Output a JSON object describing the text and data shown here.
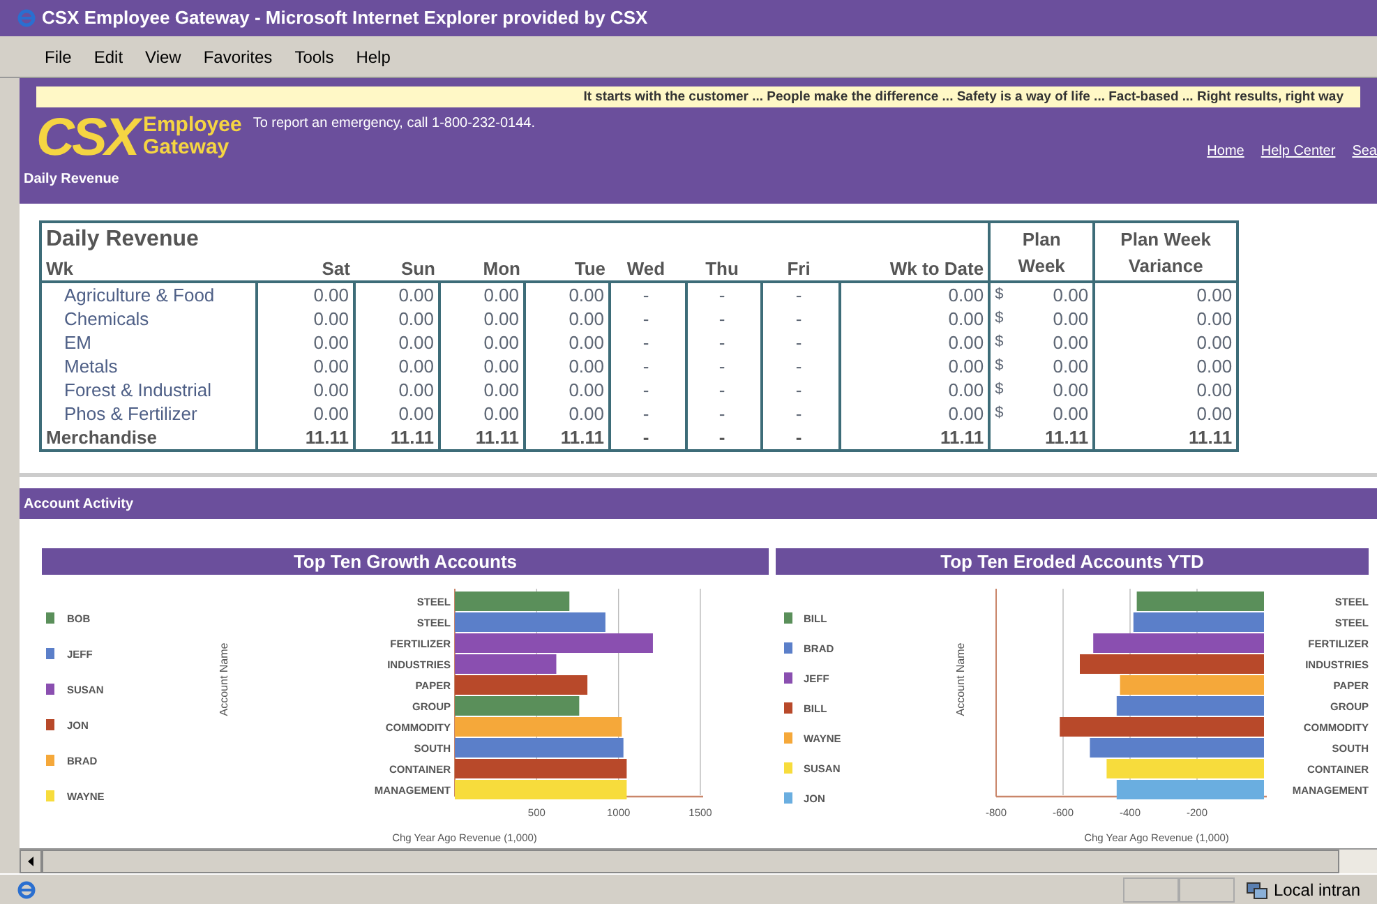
{
  "window": {
    "title": "CSX Employee Gateway - Microsoft Internet Explorer provided by CSX"
  },
  "menu": [
    "File",
    "Edit",
    "View",
    "Favorites",
    "Tools",
    "Help"
  ],
  "header": {
    "banner": "It starts with the customer ... People make the difference ... Safety is a way of life ... Fact-based ... Right results, right way",
    "logo": "CSX",
    "logo_lines": [
      "Employee",
      "Gateway"
    ],
    "emergency": "To report an emergency, call 1-800-232-0144.",
    "links": [
      "Home",
      "Help Center",
      "Sea"
    ],
    "section": "Daily Revenue"
  },
  "revenue": {
    "title": "Daily Revenue",
    "columns": [
      "Wk",
      "Sat",
      "Sun",
      "Mon",
      "Tue",
      "Wed",
      "Thu",
      "Fri",
      "Wk to Date",
      "Plan Week",
      "Plan Week Variance"
    ],
    "rows": [
      {
        "kind": "item",
        "cells": [
          "Agriculture & Food",
          "0.00",
          "0.00",
          "0.00",
          "0.00",
          "-",
          "-",
          "-",
          "0.00",
          "0.00",
          "0.00"
        ],
        "currency": "$"
      },
      {
        "kind": "item",
        "cells": [
          "Chemicals",
          "0.00",
          "0.00",
          "0.00",
          "0.00",
          "-",
          "-",
          "-",
          "0.00",
          "0.00",
          "0.00"
        ],
        "currency": "$"
      },
      {
        "kind": "item",
        "cells": [
          "EM",
          "0.00",
          "0.00",
          "0.00",
          "0.00",
          "-",
          "-",
          "-",
          "0.00",
          "0.00",
          "0.00"
        ],
        "currency": "$"
      },
      {
        "kind": "item",
        "cells": [
          "Metals",
          "0.00",
          "0.00",
          "0.00",
          "0.00",
          "-",
          "-",
          "-",
          "0.00",
          "0.00",
          "0.00"
        ],
        "currency": "$"
      },
      {
        "kind": "item",
        "cells": [
          "Forest & Industrial",
          "0.00",
          "0.00",
          "0.00",
          "0.00",
          "-",
          "-",
          "-",
          "0.00",
          "0.00",
          "0.00"
        ],
        "currency": "$"
      },
      {
        "kind": "item",
        "cells": [
          "Phos & Fertilizer",
          "0.00",
          "0.00",
          "0.00",
          "0.00",
          "-",
          "-",
          "-",
          "0.00",
          "0.00",
          "0.00"
        ],
        "currency": "$"
      },
      {
        "kind": "total",
        "cells": [
          "Merchandise",
          "11.11",
          "11.11",
          "11.11",
          "11.11",
          "-",
          "-",
          "-",
          "11.11",
          "11.11",
          "11.11"
        ]
      }
    ]
  },
  "activity": {
    "title": "Account Activity",
    "charts": [
      {
        "title": "Top Ten Growth Accounts",
        "chart_data": {
          "type": "bar",
          "orientation": "horizontal",
          "stacked": true,
          "legend": "left",
          "grid": true,
          "xlabel": "Chg Year Ago Revenue (1,000)",
          "ylabel": "Account Name",
          "categories": [
            "STEEL",
            "STEEL",
            "FERTILIZER",
            "INDUSTRIES",
            "PAPER",
            "GROUP",
            "COMMODITY",
            "SOUTH",
            "CONTAINER",
            "MANAGEMENT"
          ],
          "xlim": [
            0,
            1500
          ],
          "xticks": [
            500,
            1000,
            1500
          ],
          "series": [
            {
              "name": "BOB",
              "color": "#5a8f5a",
              "values": [
                700,
                null,
                null,
                null,
                null,
                760,
                null,
                null,
                null,
                null
              ]
            },
            {
              "name": "JEFF",
              "color": "#5b7fc9",
              "values": [
                null,
                920,
                null,
                null,
                null,
                null,
                null,
                1030,
                null,
                null
              ]
            },
            {
              "name": "SUSAN",
              "color": "#8a4fb0",
              "values": [
                null,
                null,
                1210,
                620,
                null,
                null,
                null,
                null,
                null,
                null
              ]
            },
            {
              "name": "JON",
              "color": "#b8492a",
              "values": [
                null,
                null,
                null,
                null,
                810,
                null,
                null,
                null,
                1050,
                null
              ]
            },
            {
              "name": "BRAD",
              "color": "#f5a83a",
              "values": [
                null,
                null,
                null,
                null,
                null,
                null,
                1020,
                null,
                null,
                null
              ]
            },
            {
              "name": "WAYNE",
              "color": "#f7dc3c",
              "values": [
                null,
                null,
                null,
                null,
                null,
                null,
                null,
                null,
                null,
                1050
              ]
            }
          ]
        }
      },
      {
        "title": "Top Ten Eroded Accounts YTD",
        "chart_data": {
          "type": "bar",
          "orientation": "horizontal",
          "stacked": true,
          "legend": "left",
          "grid": true,
          "xlabel": "Chg Year Ago Revenue (1,000)",
          "ylabel": "Account Name",
          "categories": [
            "STEEL",
            "STEEL",
            "FERTILIZER",
            "INDUSTRIES",
            "PAPER",
            "GROUP",
            "COMMODITY",
            "SOUTH",
            "CONTAINER",
            "MANAGEMENT"
          ],
          "xlim": [
            -800,
            0
          ],
          "xticks": [
            -800,
            -600,
            -400,
            -200
          ],
          "series": [
            {
              "name": "BILL",
              "color": "#5a8f5a",
              "values": [
                -380,
                null,
                null,
                null,
                null,
                null,
                null,
                null,
                null,
                null
              ]
            },
            {
              "name": "BRAD",
              "color": "#5b7fc9",
              "values": [
                null,
                -390,
                null,
                null,
                null,
                -440,
                null,
                -520,
                null,
                null
              ]
            },
            {
              "name": "JEFF",
              "color": "#8a4fb0",
              "values": [
                null,
                null,
                -510,
                null,
                null,
                null,
                null,
                null,
                null,
                null
              ]
            },
            {
              "name": "BILL",
              "color": "#b8492a",
              "values": [
                null,
                null,
                null,
                -550,
                null,
                null,
                -610,
                null,
                null,
                null
              ]
            },
            {
              "name": "WAYNE",
              "color": "#f5a83a",
              "values": [
                null,
                null,
                null,
                null,
                -430,
                null,
                null,
                null,
                null,
                null
              ]
            },
            {
              "name": "SUSAN",
              "color": "#f7dc3c",
              "values": [
                null,
                null,
                null,
                null,
                null,
                null,
                null,
                null,
                -470,
                null
              ]
            },
            {
              "name": "JON",
              "color": "#6aaee0",
              "values": [
                null,
                null,
                null,
                null,
                null,
                null,
                null,
                null,
                null,
                -440
              ]
            }
          ]
        }
      }
    ]
  },
  "status_bar": {
    "zone": "Local intran"
  }
}
